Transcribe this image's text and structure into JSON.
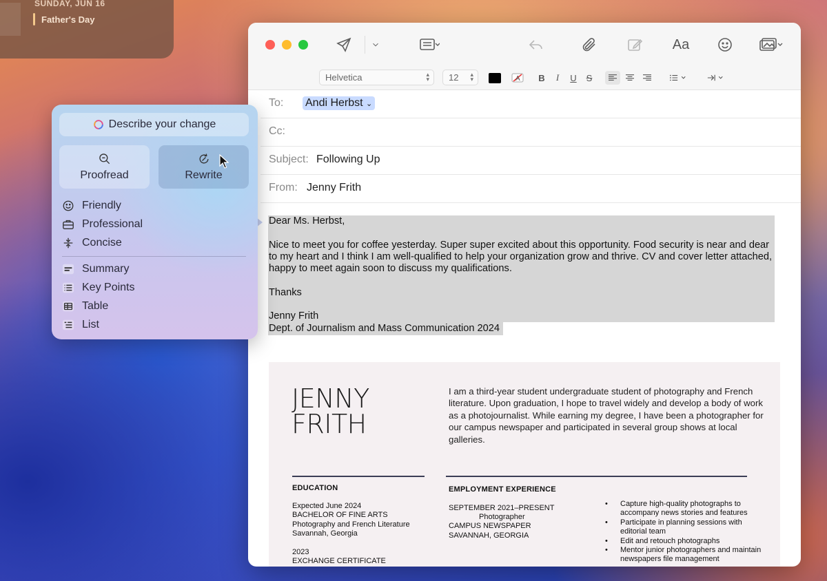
{
  "calendar": {
    "date": "SUNDAY, JUN 16",
    "event": "Father's Day"
  },
  "toolbar": {
    "icons": [
      "send-icon",
      "chevron-down-icon",
      "header-fields-icon",
      "reply-icon",
      "paperclip-icon",
      "compose-icon",
      "font-panel-icon",
      "emoji-icon",
      "photo-browser-icon"
    ],
    "font_panel_label": "Aa"
  },
  "format_bar": {
    "font": "Helvetica",
    "size": "12",
    "text_color": "#000000",
    "bold": "B",
    "italic": "I",
    "underline": "U",
    "strike": "S"
  },
  "headers": {
    "to_label": "To:",
    "to_value": "Andi Herbst",
    "cc_label": "Cc:",
    "subject_label": "Subject:",
    "subject_value": "Following Up",
    "from_label": "From:",
    "from_value": "Jenny Frith"
  },
  "body": {
    "greeting": "Dear Ms. Herbst,",
    "para_line1": "Nice to meet you for coffee yesterday. Super super excited about this opportunity. Food security is near and dear",
    "para_line2": "to my heart and I think I am well-qualified to help your organization grow and thrive. CV and cover letter attached,",
    "para_line3": "happy to meet again soon to discuss my qualifications.",
    "closing": "Thanks",
    "signature_name": "Jenny Frith",
    "signature_dept": "Dept. of Journalism and Mass Communication 2024"
  },
  "resume": {
    "name_line1": "JENNY",
    "name_line2": "FRITH",
    "bio": "I am a third-year student undergraduate student of photography and French literature. Upon graduation, I hope to travel widely and develop a body of work as a photojournalist. While earning my degree, I have been a photographer for our campus newspaper and participated in several group shows at local galleries.",
    "education_title": "EDUCATION",
    "edu1_line1": "Expected June 2024",
    "edu1_line2": "BACHELOR OF FINE ARTS",
    "edu1_line3": "Photography and French Literature",
    "edu1_line4": "Savannah, Georgia",
    "edu2_line1": "2023",
    "edu2_line2": "EXCHANGE CERTIFICATE",
    "employment_title": "EMPLOYMENT EXPERIENCE",
    "job_dates": "SEPTEMBER 2021–PRESENT",
    "job_title": "Photographer",
    "job_org": "CAMPUS NEWSPAPER",
    "job_place": "SAVANNAH, GEORGIA",
    "bullets": [
      "Capture high-quality photographs to accompany news stories and features",
      "Participate in planning sessions with editorial team",
      "Edit and retouch photographs",
      "Mentor junior photographers and maintain newspapers file management"
    ]
  },
  "writing_tools": {
    "describe": "Describe your change",
    "proofread": "Proofread",
    "rewrite": "Rewrite",
    "friendly": "Friendly",
    "professional": "Professional",
    "concise": "Concise",
    "summary": "Summary",
    "key_points": "Key Points",
    "table": "Table",
    "list": "List"
  }
}
